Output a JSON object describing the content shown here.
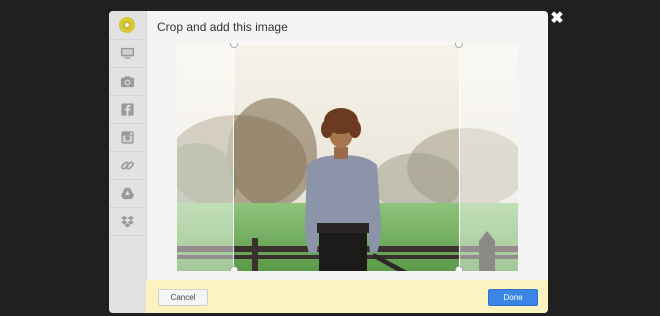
{
  "dialog": {
    "title": "Crop and add this image"
  },
  "close": {
    "glyph": "✖"
  },
  "sidebar": {
    "items": [
      {
        "icon": "monitor-icon"
      },
      {
        "icon": "camera-icon"
      },
      {
        "icon": "facebook-icon"
      },
      {
        "icon": "instagram-icon"
      },
      {
        "icon": "link-icon"
      },
      {
        "icon": "google-drive-icon"
      },
      {
        "icon": "dropbox-icon"
      }
    ]
  },
  "footer": {
    "cancel_label": "Cancel",
    "done_label": "Done"
  },
  "colors": {
    "footer_bg": "#fdf3c1",
    "done_button": "#3a85e6",
    "brand_dot": "#c8b92a"
  }
}
